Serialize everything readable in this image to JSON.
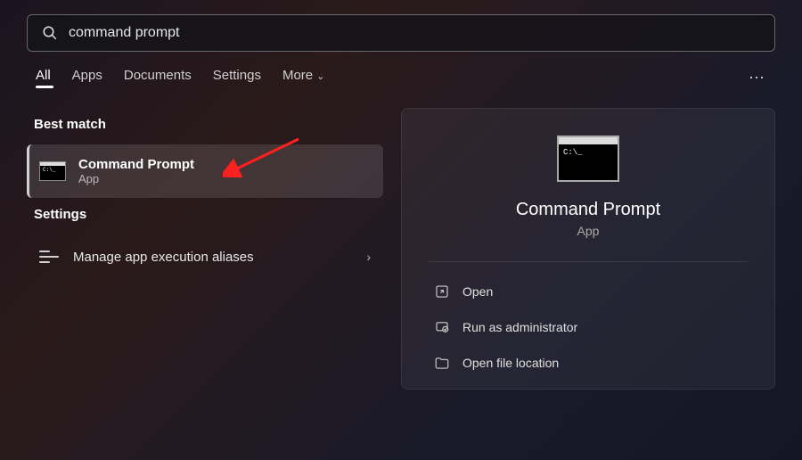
{
  "search": {
    "query": "command prompt"
  },
  "tabs": {
    "all": "All",
    "apps": "Apps",
    "documents": "Documents",
    "settings": "Settings",
    "more": "More"
  },
  "sections": {
    "best_match": "Best match",
    "settings": "Settings"
  },
  "results": {
    "best_match": {
      "title": "Command Prompt",
      "subtitle": "App"
    },
    "settings_item": {
      "label": "Manage app execution aliases"
    }
  },
  "detail": {
    "title": "Command Prompt",
    "subtitle": "App",
    "actions": {
      "open": "Open",
      "run_admin": "Run as administrator",
      "open_location": "Open file location"
    }
  }
}
